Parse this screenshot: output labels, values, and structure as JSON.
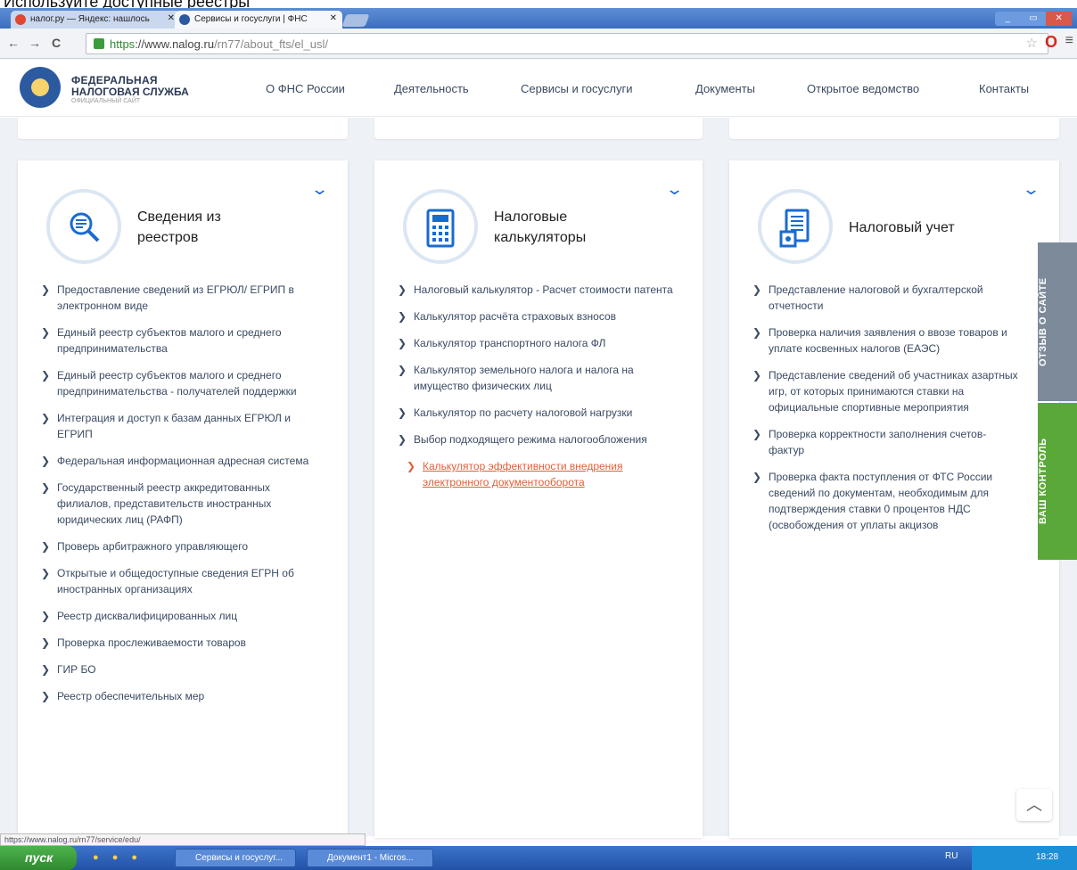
{
  "top_strip_text": "Используйте доступные реестры",
  "browser": {
    "tabs": [
      {
        "label": "налог.ру — Яндекс: нашлось",
        "active": false
      },
      {
        "label": "Сервисы и госуслуги | ФНС",
        "active": true
      }
    ],
    "window_buttons": [
      "_",
      "▭",
      "✕"
    ],
    "back": "←",
    "forward": "→",
    "reload": "C",
    "url_scheme": "https",
    "url_host": "://www.nalog.ru",
    "url_path": "/rn77/about_fts/el_usl/",
    "star": "☆",
    "opera_logo": "O",
    "menu": "≡"
  },
  "site": {
    "brand_line1": "ФЕДЕРАЛЬНАЯ",
    "brand_line2": "НАЛОГОВАЯ СЛУЖБА",
    "brand_line3": "ОФИЦИАЛЬНЫЙ САЙТ",
    "nav": [
      "О ФНС России",
      "Деятельность",
      "Сервисы и госуслуги",
      "Документы",
      "Открытое ведомство",
      "Контакты"
    ]
  },
  "cards": [
    {
      "title_line1": "Сведения из",
      "title_line2": "реестров",
      "items": [
        "Предоставление сведений из ЕГРЮЛ/ ЕГРИП в электронном виде",
        "Единый реестр субъектов малого и среднего предпринимательства",
        "Единый реестр субъектов малого и среднего предпринимательства - получателей поддержки",
        "Интеграция и доступ к базам данных ЕГРЮЛ и ЕГРИП",
        "Федеральная информационная адресная система",
        "Государственный реестр аккредитованных филиалов, представительств иностранных юридических лиц (РАФП)",
        "Проверь арбитражного управляющего",
        "Открытые и общедоступные сведения ЕГРН об иностранных организациях",
        "Реестр дисквалифицированных лиц",
        "Проверка прослеживаемости товаров",
        "ГИР БО",
        "Реестр обеспечительных мер"
      ]
    },
    {
      "title_line1": "Налоговые",
      "title_line2": "калькуляторы",
      "items": [
        "Налоговый калькулятор - Расчет стоимости патента",
        "Калькулятор расчёта страховых взносов",
        "Калькулятор транспортного налога ФЛ",
        "Калькулятор земельного налога и налога на имущество физических лиц",
        "Калькулятор по расчету налоговой нагрузки",
        "Выбор подходящего режима налогообложения",
        "Калькулятор эффективности внедрения электронного документооборота"
      ],
      "active_item": "Калькулятор эффективности внедрения электронного документооборота"
    },
    {
      "title_line1": "Налоговый учет",
      "title_line2": "",
      "items": [
        "Представление налоговой и бухгалтерской отчетности",
        "Проверка наличия заявления о ввозе товаров и уплате косвенных налогов (ЕАЭС)",
        "Представление сведений об участниках азартных игр, от которых принимаются ставки на официальные спортивные мероприятия",
        "Проверка корректности заполнения счетов-фактур",
        "Проверка факта поступления от ФТС России сведений по документам, необходимым для подтверждения ставки 0 процентов НДС (освобождения от уплаты акцизов"
      ]
    }
  ],
  "side_tabs": [
    {
      "label": "ОТЗЫВ О САЙТЕ",
      "color": "#7d8a9a"
    },
    {
      "label": "ВАШ КОНТРОЛЬ",
      "color": "#5aa83a"
    }
  ],
  "chevron": "❯",
  "expand_icon": "⌄",
  "scroll_top": "︿",
  "status_url": "https://www.nalog.ru/rn77/service/edu/",
  "taskbar": {
    "start_label": "пуск",
    "tasks": [
      "Сервисы и госуслуг...",
      "Документ1 - Micros..."
    ],
    "lang": "RU",
    "clock": "18:28"
  },
  "colors": {
    "accent_blue": "#1a6bd1",
    "active_link": "#e0603a",
    "link_text": "#3a4a62",
    "bg": "#eef2f7"
  }
}
